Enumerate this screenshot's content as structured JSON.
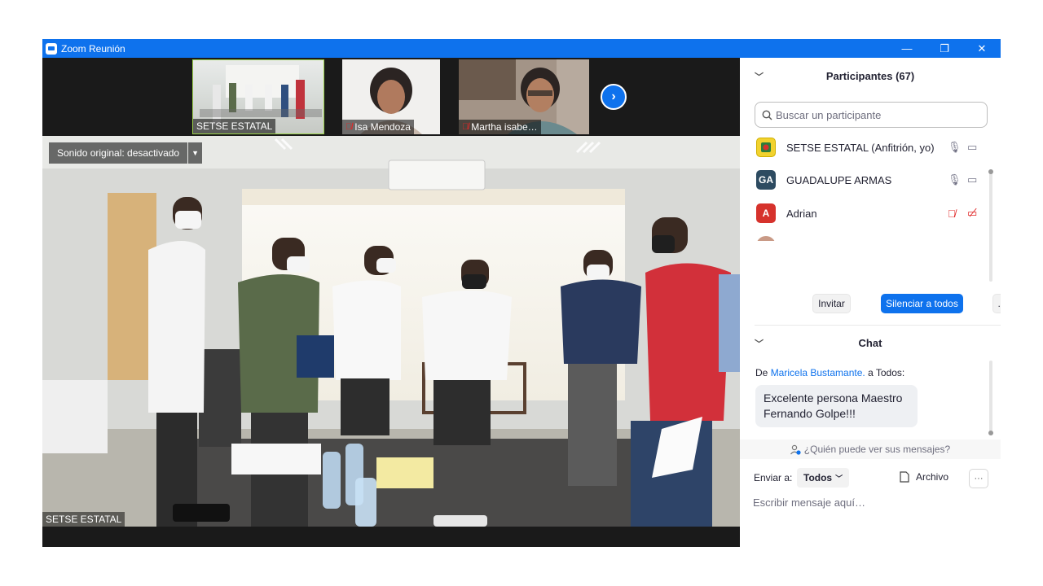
{
  "window": {
    "title": "Zoom Reunión",
    "minimize": "—",
    "restore": "❐",
    "close": "✕"
  },
  "gallery": {
    "thumbs": [
      {
        "name": "SETSE ESTATAL",
        "muted": false
      },
      {
        "name": "Isa Mendoza",
        "muted": true
      },
      {
        "name": "Martha isabe…",
        "muted": true
      }
    ],
    "next_label": "›"
  },
  "main_video": {
    "original_sound": "Sonido original: desactivado",
    "speaker_name": "SETSE ESTATAL"
  },
  "participants": {
    "header": "Participantes (67)",
    "search_placeholder": "Buscar un participante",
    "list": [
      {
        "initials": "",
        "name": "SETSE ESTATAL (Anfitrión, yo)",
        "avatar_color": "#f2d22e",
        "muted": false
      },
      {
        "initials": "GA",
        "name": "GUADALUPE ARMAS",
        "avatar_color": "#2d4b61",
        "muted": false
      },
      {
        "initials": "A",
        "name": "Adrian",
        "avatar_color": "#d6322c",
        "muted": true
      }
    ],
    "invite": "Invitar",
    "mute_all": "Silenciar a todos",
    "more": "…"
  },
  "chat": {
    "header": "Chat",
    "from_prefix": "De",
    "from_name": "Maricela Bustamante.",
    "to_text": "a Todos:",
    "message": "Excelente persona Maestro Fernando Golpe!!!",
    "who_can_see": "¿Quién puede ver sus mensajes?",
    "send_to_label": "Enviar a:",
    "send_to_value": "Todos",
    "file_label": "Archivo",
    "more": "···",
    "input_placeholder": "Escribir mensaje aquí…"
  },
  "colors": {
    "accent": "#0e72ed",
    "muted_red": "#e02828"
  }
}
